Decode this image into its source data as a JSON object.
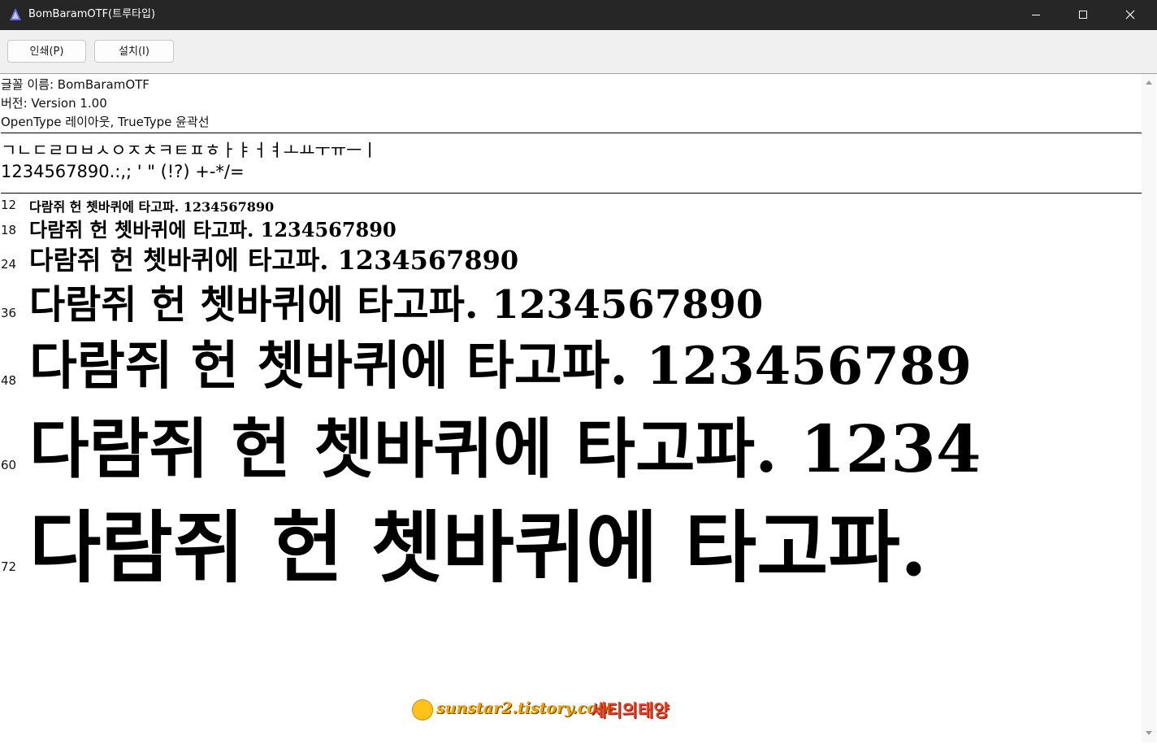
{
  "window": {
    "title": "BomBaramOTF(트루타입)",
    "icon": "font-app-icon",
    "controls": [
      "minimize-icon",
      "maximize-icon",
      "close-icon"
    ]
  },
  "toolbar": {
    "print_label": "인쇄(P)",
    "install_label": "설치(I)"
  },
  "info": {
    "font_name": "글꼴 이름: BomBaramOTF",
    "version": "버전: Version 1.00",
    "outline": "OpenType 레이아웃, TrueType 윤곽선"
  },
  "charset": {
    "jamo": "ㄱㄴㄷㄹㅁㅂㅅㅇㅈㅊㅋㅌㅍㅎㅏㅑㅓㅕㅗㅛㅜㅠㅡㅣ",
    "digits_symbols": "1234567890.:,; ' \" (!?) +-*/="
  },
  "samples": [
    {
      "size": "12",
      "text": "다람쥐 헌 쳇바퀴에 타고파. 1234567890"
    },
    {
      "size": "18",
      "text": "다람쥐 헌 쳇바퀴에 타고파. 1234567890"
    },
    {
      "size": "24",
      "text": "다람쥐 헌 쳇바퀴에 타고파. 1234567890"
    },
    {
      "size": "36",
      "text": "다람쥐 헌 쳇바퀴에 타고파. 1234567890"
    },
    {
      "size": "48",
      "text": "다람쥐 헌 쳇바퀴에 타고파. 123456789"
    },
    {
      "size": "60",
      "text": "다람쥐 헌 쳇바퀴에 타고파. 1234"
    },
    {
      "size": "72",
      "text": "다람쥐 헌 쳇바퀴에 타고파."
    }
  ],
  "watermark": {
    "url": "sunstar2.tistory.com",
    "name": "세티의태양"
  },
  "colors": {
    "titlebar": "#262626",
    "toolbar": "#f0f0f0",
    "watermark_url": "#f2a400",
    "watermark_name": "#e8402a"
  }
}
